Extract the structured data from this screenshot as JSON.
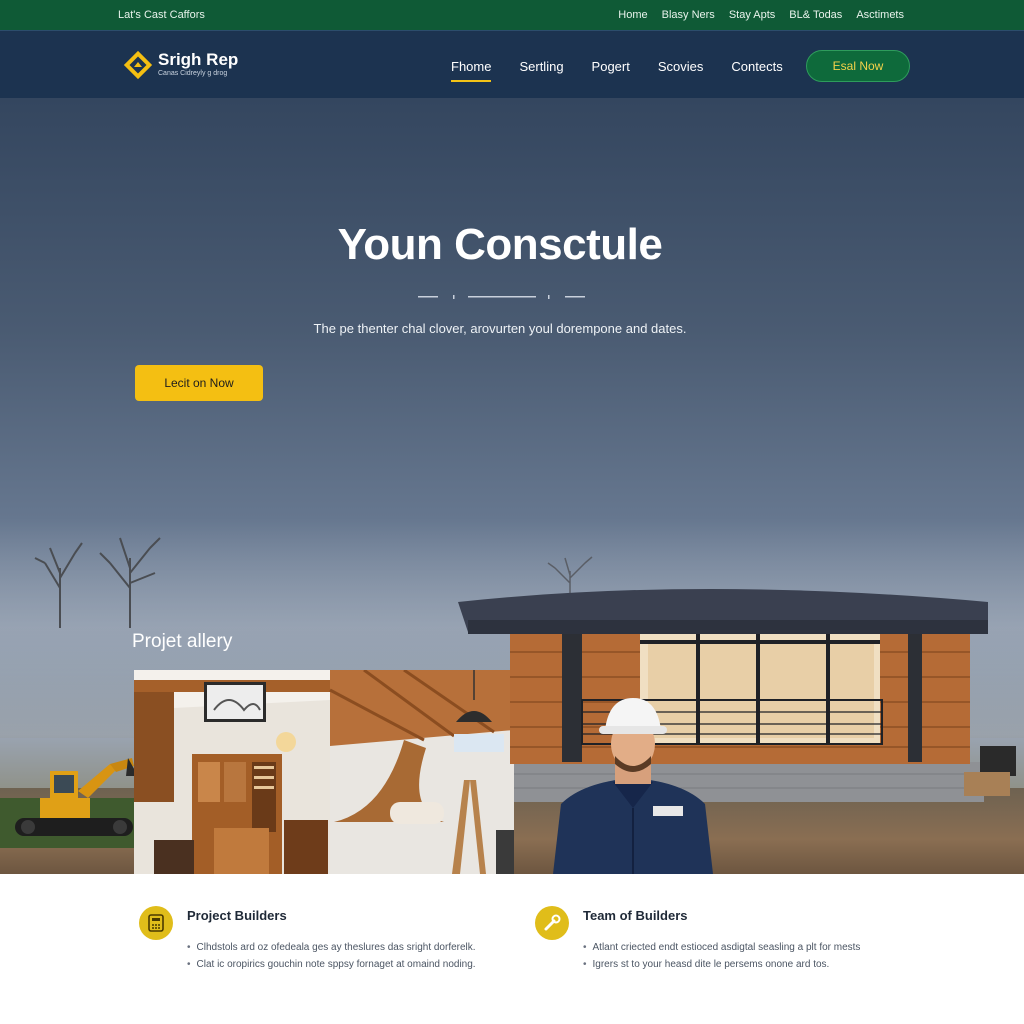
{
  "topbar": {
    "left_text": "Lat's Cast Caffors",
    "links": [
      "Home",
      "Blasy Ners",
      "Stay Apts",
      "BL& Todas",
      "Asctimets"
    ]
  },
  "brand": {
    "name": "Srigh Rep",
    "tagline": "Canas Cidreyly g drog"
  },
  "nav": {
    "links": [
      "Fhome",
      "Sertling",
      "Pogert",
      "Scovies",
      "Contects"
    ],
    "active_index": 0,
    "cta": "Esal Now"
  },
  "hero": {
    "title": "Youn Consctule",
    "subtitle": "The pe thenter chal clover, arovurten youl dorempone and dates.",
    "button": "Lecit on Now",
    "gallery_title": "Projet allery"
  },
  "features": [
    {
      "icon": "calculator-icon",
      "title": "Project Builders",
      "bullets": [
        "Clhdstols ard oz ofedeala ges ay theslures das sright dorferelk.",
        "Clat ic oropirics gouchin note sppsy fornaget at omaind noding."
      ]
    },
    {
      "icon": "wrench-icon",
      "title": "Team of Builders",
      "bullets": [
        "Atlant criected endt estioced asdigtal seasling a plt for mests",
        "Igrers st to your heasd dite le persems onone ard tos."
      ]
    }
  ],
  "colors": {
    "topbar": "#0f5a36",
    "navbar": "#1c3350",
    "accent_yellow": "#f4bf12",
    "cta_green": "#0e6a3b"
  }
}
